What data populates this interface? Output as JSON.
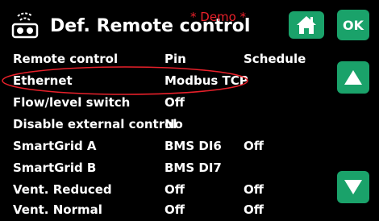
{
  "header": {
    "title": "Def. Remote control",
    "demo_label": "* Demo *",
    "ok_label": "OK"
  },
  "table": {
    "headers": [
      "Remote control",
      "Pin",
      "Schedule"
    ],
    "rows": [
      {
        "name": "Ethernet",
        "pin": "Modbus TCP",
        "schedule": ""
      },
      {
        "name": "Flow/level switch",
        "pin": "Off",
        "schedule": ""
      },
      {
        "name": "Disable external control",
        "pin": "No",
        "schedule": ""
      },
      {
        "name": "SmartGrid A",
        "pin": "BMS DI6",
        "schedule": "Off"
      },
      {
        "name": "SmartGrid B",
        "pin": "BMS DI7",
        "schedule": ""
      },
      {
        "name": "Vent. Reduced",
        "pin": "Off",
        "schedule": "Off"
      },
      {
        "name": "Vent. Normal",
        "pin": "Off",
        "schedule": "Off"
      }
    ]
  },
  "icons": {
    "header": "remote-control-icon",
    "home": "home-icon",
    "up": "arrow-up-icon",
    "down": "arrow-down-icon"
  },
  "colors": {
    "accent": "#1aa26a",
    "demo": "#e8202a",
    "highlight": "#e8202a"
  }
}
